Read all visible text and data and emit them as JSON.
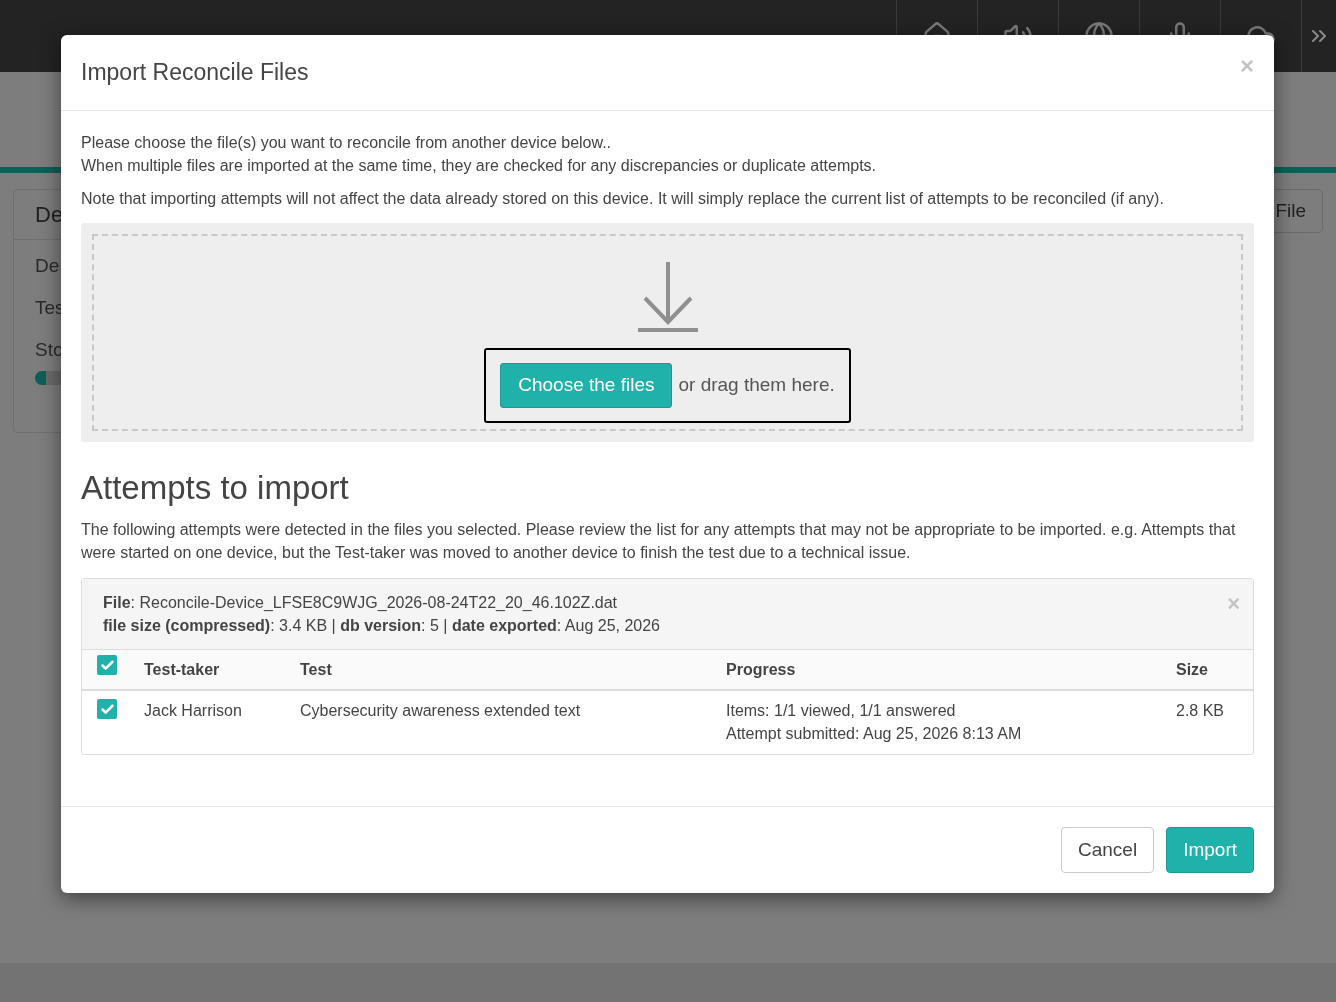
{
  "background": {
    "card": {
      "title": "De",
      "items": [
        "De",
        "Tes",
        "Sto"
      ],
      "progress": {
        "level": 0.03
      }
    },
    "file_button": "File"
  },
  "dialog": {
    "title": "Import Reconcile Files",
    "close": "×",
    "intro": [
      "Please choose the file(s) you want to reconcile from another device below..",
      "When multiple files are imported at the same time, they are checked for any discrepancies or duplicate attempts."
    ],
    "note": "Note that importing attempts will not affect the data already stored on this device. It will simply replace the current list of attempts to be reconciled (if any).",
    "dropzone": {
      "button": "Choose the files",
      "hint": "or drag them here."
    },
    "attempts": {
      "heading": "Attempts to import",
      "description": "The following attempts were detected in the files you selected. Please review the list for any attempts that may not be appropriate to be imported. e.g. Attempts that were started on one device, but the Test-taker was moved to another device to finish the test due to a technical issue.",
      "files": [
        {
          "name": "**File**: Reconcile-Device_LFSE8C9WJG_2026-08-24T22_20_46.102Z.dat",
          "meta": "**file size (compressed)**: 3.4 KB | **db version**: 5 | **date exported**: Aug 25, 2026",
          "close": "×",
          "select_all": {
            "checked": true
          },
          "columns": [
            "Test-taker",
            "Test",
            "Progress",
            "Size"
          ],
          "rows": [
            {
              "checked": true,
              "test_taker": "Jack Harrison",
              "test": "Cybersecurity awareness extended text",
              "progress": [
                "Items: 1/1 viewed, 1/1 answered",
                "Attempt submitted: Aug 25, 2026 8:13 AM"
              ],
              "size": "2.8 KB"
            }
          ]
        }
      ]
    },
    "buttons": [
      {
        "label": "Cancel",
        "kind": "default"
      },
      {
        "label": "Import",
        "kind": "primary"
      }
    ]
  }
}
